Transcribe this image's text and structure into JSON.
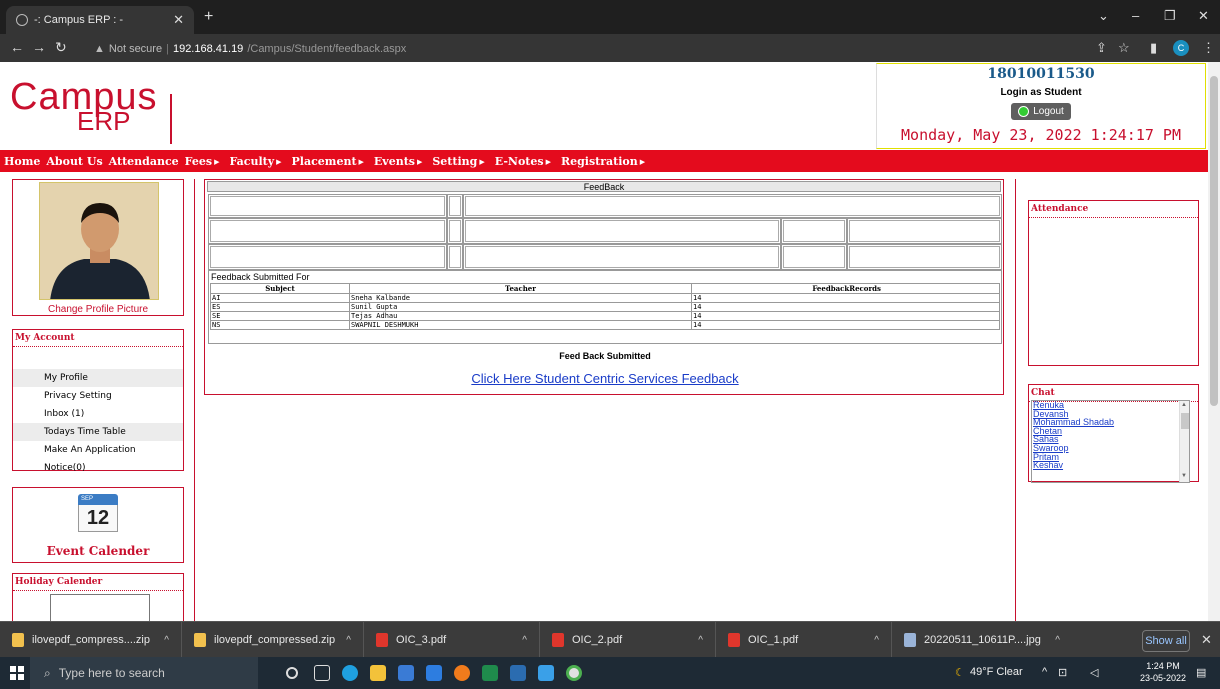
{
  "browser": {
    "tab_title": "-: Campus ERP : -",
    "url_secure": "Not secure",
    "url_host": "192.168.41.19",
    "url_path": "/Campus/Student/feedback.aspx",
    "profile_initial": "C"
  },
  "header": {
    "logo_campus": "Campus",
    "logo_erp": "ERP",
    "user_id": "18010011530",
    "login_as": "Login as Student",
    "logout_label": "Logout",
    "datetime": "Monday, May 23, 2022 1:24:17 PM"
  },
  "menu": [
    "Home",
    "About Us",
    "Attendance",
    "Fees",
    "Faculty",
    "Placement",
    "Events",
    "Setting",
    "E-Notes",
    "Registration"
  ],
  "sidebar": {
    "change_picture": "Change Profile Picture",
    "my_account": "My Account",
    "items": [
      "My Profile",
      "Privacy Setting",
      "Inbox (1)",
      "Todays Time Table",
      "Make An Application",
      "Notice(0)"
    ],
    "calendar_month": "SEP",
    "calendar_day": "12",
    "event_calendar": "Event Calender",
    "holiday_calendar": "Holiday Calender"
  },
  "feedback": {
    "title": "FeedBack",
    "submitted_for": "Feedback Submitted For",
    "columns": [
      "Subject",
      "Teacher",
      "FeedbackRecords"
    ],
    "rows": [
      [
        "AI",
        "Sneha Kalbande",
        "14"
      ],
      [
        "ES",
        "Sunil Gupta",
        "14"
      ],
      [
        "SE",
        "Tejas Adhau",
        "14"
      ],
      [
        "NS",
        "SWAPNIL DESHMUKH",
        "14"
      ]
    ],
    "status": "Feed Back Submitted",
    "link": "Click Here Student Centric Services Feedback"
  },
  "right": {
    "attendance": "Attendance",
    "chat": "Chat",
    "chat_users": [
      "Renuka",
      "Devansh",
      "Mohammad Shadab",
      "Chetan",
      "Sahas",
      "Swaroop",
      "Pritam",
      "Keshav"
    ]
  },
  "downloads": {
    "items": [
      "ilovepdf_compress....zip",
      "ilovepdf_compressed.zip",
      "OIC_3.pdf",
      "OIC_2.pdf",
      "OIC_1.pdf",
      "20220511_10611P....jpg"
    ],
    "show_all": "Show all"
  },
  "taskbar": {
    "search_placeholder": "Type here to search",
    "weather": "49°F  Clear",
    "time": "1:24 PM",
    "date": "23-05-2022"
  }
}
